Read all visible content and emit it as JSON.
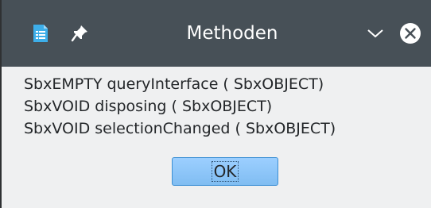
{
  "window": {
    "title": "Methoden"
  },
  "methods": [
    "SbxEMPTY queryInterface ( SbxOBJECT)",
    "SbxVOID disposing ( SbxOBJECT)",
    "SbxVOID selectionChanged ( SbxOBJECT)"
  ],
  "buttons": {
    "ok_label": "OK"
  },
  "icons": {
    "app": "document-app-icon",
    "pin": "pin-icon",
    "minimize": "chevron-down-icon",
    "close": "close-icon"
  },
  "colors": {
    "titlebar": "#475057",
    "background": "#eff0f1",
    "button": "#8cc6f9",
    "button_border": "#3b8fd4"
  }
}
